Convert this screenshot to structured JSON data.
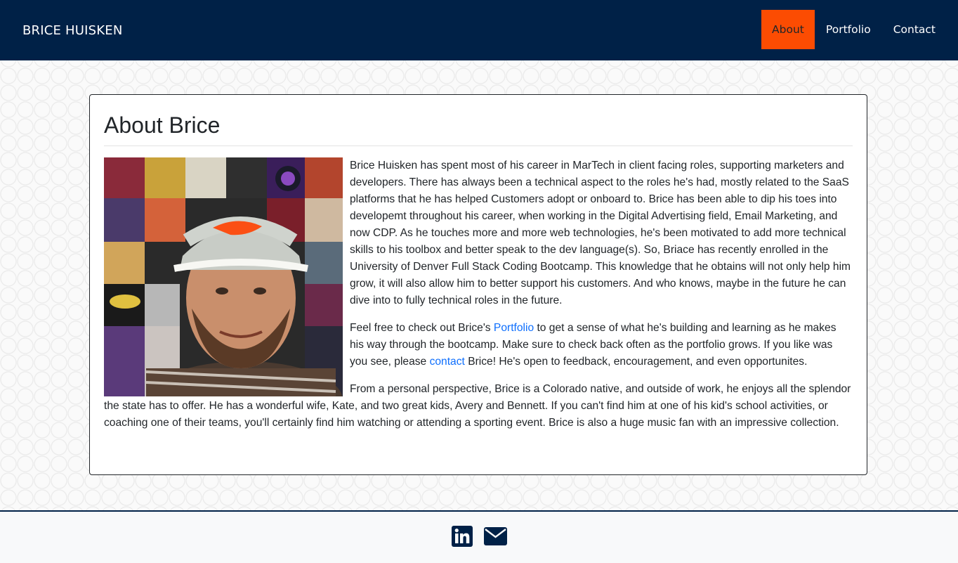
{
  "nav": {
    "brand": "BRICE HUISKEN",
    "links": [
      {
        "label": "About",
        "active": true
      },
      {
        "label": "Portfolio",
        "active": false
      },
      {
        "label": "Contact",
        "active": false
      }
    ]
  },
  "about": {
    "title": "About Brice",
    "p1": "Brice Huisken has spent most of his career in MarTech in client facing roles, supporting marketers and developers. There has always been a technical aspect to the roles he's had, mostly related to the SaaS platforms that he has helped Customers adopt or onboard to. Brice has been able to dip his toes into developemt throughout his career, when working in the Digital Advertising field, Email Marketing, and now CDP. As he touches more and more web technologies, he's been motivated to add more technical skills to his toolbox and better speak to the dev language(s). So, Briace has recently enrolled in the University of Denver Full Stack Coding Bootcamp. This knowledge that he obtains will not only help him grow, it will also allow him to better support his customers. And who knows, maybe in the future he can dive into to fully technical roles in the future.",
    "p2_before": "Feel free to check out Brice's ",
    "p2_link1": "Portfolio",
    "p2_mid": " to get a sense of what he's building and learning as he makes his way through the bootcamp. Make sure to check back often as the portfolio grows. If you like was you see, please ",
    "p2_link2": "contact",
    "p2_after": " Brice! He's open to feedback, encouragement, and even opportunites.",
    "p3": "From a personal perspective, Brice is a Colorado native, and outside of work, he enjoys all the splendor the state has to offer. He has a wonderful wife, Kate, and two great kids, Avery and Bennett. If you can't find him at one of his kid's school activities, or coaching one of their teams, you'll certainly find him watching or attending a sporting event. Brice is also a huge music fan with an impressive collection."
  },
  "footer": {
    "icons": [
      "linkedin-icon",
      "envelope-icon"
    ]
  },
  "colors": {
    "navbar": "#002147",
    "active": "#fc4c02",
    "link": "#0d6efd"
  }
}
